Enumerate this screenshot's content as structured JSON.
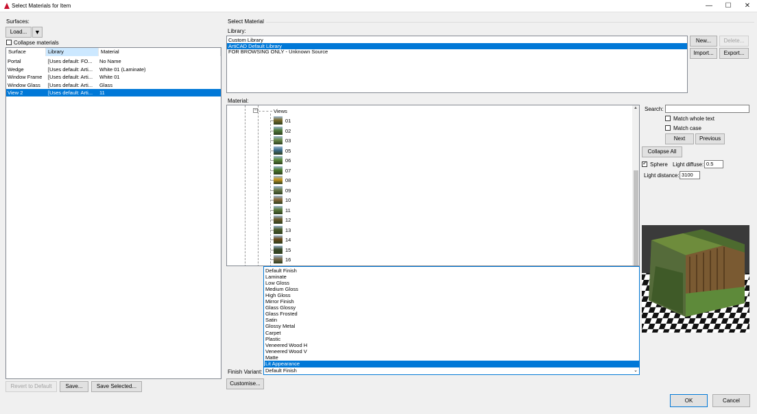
{
  "window": {
    "title": "Select Materials for Item",
    "minimize": "—",
    "maximize": "☐",
    "close": "✕"
  },
  "surfaces": {
    "label": "Surfaces:",
    "load_label": "Load...",
    "dropdown_glyph": "▼",
    "collapse_label": "Collapse materials",
    "headers": [
      "Surface",
      "Library",
      "Material"
    ],
    "rows": [
      {
        "surface": "Portal",
        "library": "[Uses default: FO...",
        "material": "No Name",
        "selected": false
      },
      {
        "surface": "Wedge",
        "library": "[Uses default: Arti...",
        "material": "White 01 (Laminate)",
        "selected": false
      },
      {
        "surface": "Window Frame",
        "library": "[Uses default: Arti...",
        "material": "White 01",
        "selected": false
      },
      {
        "surface": "Window Glass",
        "library": "[Uses default: Arti...",
        "material": "Glass",
        "selected": false
      },
      {
        "surface": "View 2",
        "library": "[Uses default: Arti...",
        "material": "11",
        "selected": true
      }
    ],
    "revert_label": "Revert to Default",
    "save_label": "Save...",
    "save_selected_label": "Save Selected..."
  },
  "select_material": {
    "group_label": "Select Material",
    "library_label": "Library:",
    "libraries": [
      {
        "name": "Custom Library",
        "selected": false
      },
      {
        "name": "ArtiCAD Default Library",
        "selected": true
      },
      {
        "name": "FOR BROWSING ONLY - Unknown Source",
        "selected": false
      }
    ],
    "new_label": "New...",
    "delete_label": "Delete...",
    "import_label": "Import...",
    "export_label": "Export...",
    "material_label": "Material:",
    "tree": {
      "folder": "Views",
      "items": [
        "01",
        "02",
        "03",
        "05",
        "06",
        "07",
        "08",
        "09",
        "10",
        "11",
        "12",
        "13",
        "14",
        "15",
        "16"
      ]
    },
    "finishes": [
      "Default Finish",
      "Laminate",
      "Low Gloss",
      "Medium Gloss",
      "High Gloss",
      "Mirror Finish",
      "Glass Glossy",
      "Glass Frosted",
      "Satin",
      "Glossy Metal",
      "Carpet",
      "Plastic",
      "Veneered Wood H",
      "Veneered Wood V",
      "Matte",
      "Lit Appearance"
    ],
    "selected_finish": "Lit Appearance",
    "finish_variant_label": "Finish Variant:",
    "finish_variant_value": "Default Finish",
    "customise_label": "Customise..."
  },
  "search": {
    "label": "Search:",
    "value": "",
    "match_whole_label": "Match whole text",
    "match_case_label": "Match case",
    "next_label": "Next",
    "previous_label": "Previous",
    "collapse_all_label": "Collapse All",
    "sphere_label": "Sphere",
    "sphere_checked": true,
    "light_diffuse_label": "Light diffuse:",
    "light_diffuse_value": "0.5",
    "light_distance_label": "Light distance:",
    "light_distance_value": "3100"
  },
  "footer": {
    "ok_label": "OK",
    "cancel_label": "Cancel"
  },
  "colors": {
    "selection": "#0078d7",
    "accent_red": "#c8102e"
  }
}
